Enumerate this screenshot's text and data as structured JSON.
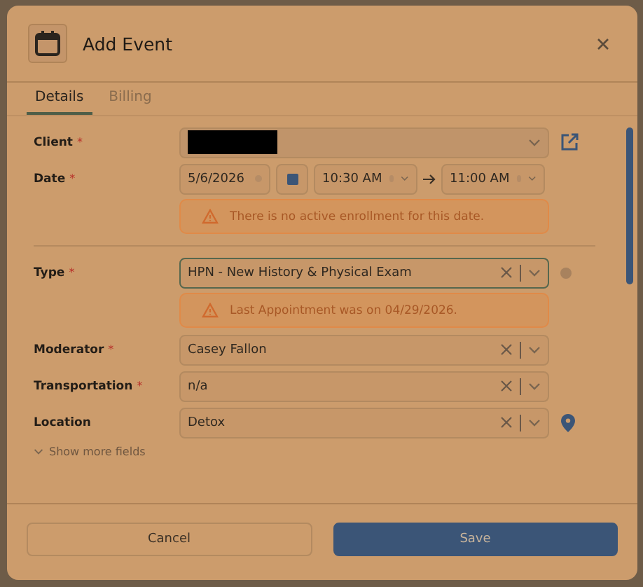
{
  "dialog": {
    "title": "Add Event"
  },
  "tabs": [
    {
      "label": "Details",
      "selected": true
    },
    {
      "label": "Billing",
      "selected": false
    }
  ],
  "sections": [
    [
      {
        "kind": "client",
        "label": "Client",
        "required_mark": "*"
      },
      {
        "kind": "datetime",
        "label": "Date",
        "required_mark": "*",
        "date": "5/6/2026",
        "start": "10:30 AM",
        "end": "11:00 AM",
        "alert": "There is no active enrollment for this date."
      }
    ],
    [
      {
        "kind": "type",
        "label": "Type",
        "required_mark": "*",
        "value": "HPN - New History & Physical Exam",
        "focused": true,
        "alert": "Last Appointment was on 04/29/2026."
      },
      {
        "kind": "select",
        "label": "Moderator",
        "required_mark": "*",
        "value": "Casey Fallon",
        "focused": false
      },
      {
        "kind": "select",
        "label": "Transportation",
        "required_mark": "*",
        "value": "n/a",
        "focused": false
      },
      {
        "kind": "location",
        "label": "Location",
        "value": "Detox",
        "focused": false
      }
    ]
  ],
  "more_link": "Show more fields",
  "buttons": [
    {
      "kind": "secondary",
      "label": "Cancel"
    },
    {
      "kind": "primary",
      "label": "Save"
    }
  ]
}
